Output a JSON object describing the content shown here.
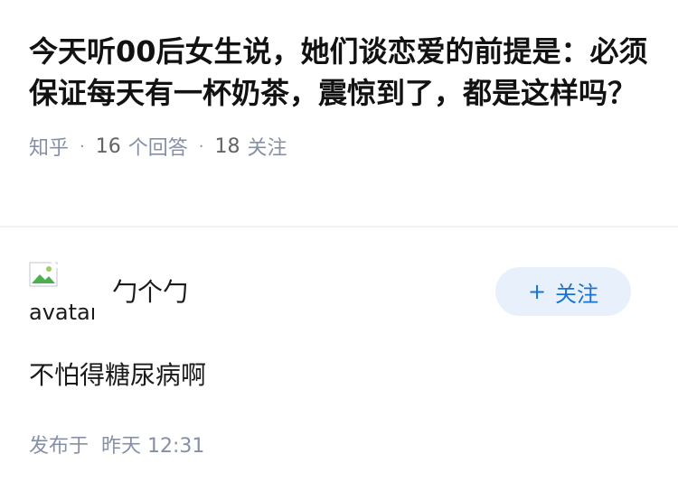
{
  "question": {
    "title": "今天听00后女生说，她们谈恋爱的前提是：必须保证每天有一杯奶茶，震惊到了，都是这样吗？",
    "site": "知乎",
    "answer_count": "16",
    "answer_label": "个回答",
    "follow_count": "18",
    "follow_label": "关注"
  },
  "answer": {
    "avatar_alt": "avatar",
    "author_name": "勹个勹",
    "follow_button": {
      "icon": "+",
      "label": "关注"
    },
    "content": "不怕得糖尿病啊",
    "published_label": "发布于",
    "published_time": "昨天 12:31"
  },
  "colors": {
    "accent": "#1772d3",
    "button_bg": "#e8f1fb",
    "meta": "#8590a6"
  }
}
